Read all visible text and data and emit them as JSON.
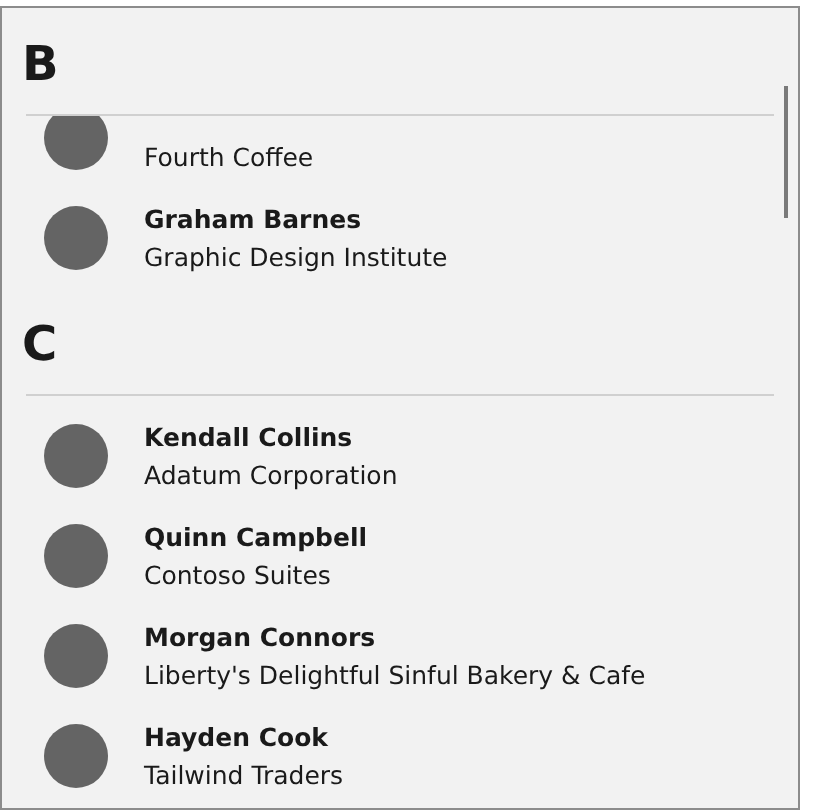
{
  "groups": [
    {
      "letter": "B",
      "contacts": [
        {
          "kind": "partial",
          "company": "Fourth Coffee"
        },
        {
          "kind": "full",
          "name": "Graham Barnes",
          "company": "Graphic Design Institute"
        }
      ]
    },
    {
      "letter": "C",
      "contacts": [
        {
          "kind": "full",
          "name": "Kendall Collins",
          "company": "Adatum Corporation"
        },
        {
          "kind": "full",
          "name": "Quinn Campbell",
          "company": "Contoso Suites"
        },
        {
          "kind": "full",
          "name": "Morgan Connors",
          "company": "Liberty's Delightful Sinful Bakery & Cafe"
        },
        {
          "kind": "full",
          "name": "Hayden Cook",
          "company": "Tailwind Traders"
        }
      ]
    }
  ]
}
